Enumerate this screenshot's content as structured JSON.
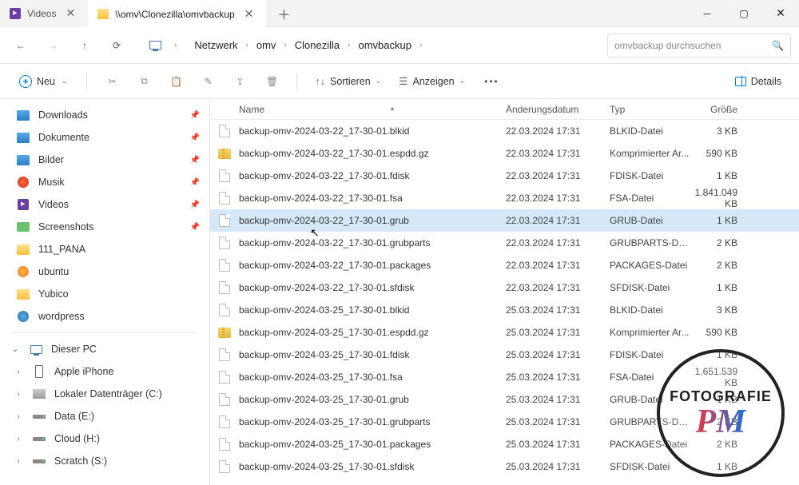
{
  "tabs": [
    {
      "label": "Videos",
      "active": false,
      "icon": "video"
    },
    {
      "label": "\\\\omv\\Clonezilla\\omvbackup",
      "active": true,
      "icon": "folder"
    }
  ],
  "breadcrumb": [
    "Netzwerk",
    "omv",
    "Clonezilla",
    "omvbackup"
  ],
  "search_placeholder": "omvbackup durchsuchen",
  "toolbar": {
    "new": "Neu",
    "sort": "Sortieren",
    "view": "Anzeigen",
    "details": "Details"
  },
  "sidebar": {
    "quick": [
      {
        "label": "Downloads",
        "icon": "folder",
        "pinned": true
      },
      {
        "label": "Dokumente",
        "icon": "folder",
        "pinned": true
      },
      {
        "label": "Bilder",
        "icon": "folder",
        "pinned": true
      },
      {
        "label": "Musik",
        "icon": "music",
        "pinned": true
      },
      {
        "label": "Videos",
        "icon": "video",
        "pinned": true
      },
      {
        "label": "Screenshots",
        "icon": "camera",
        "pinned": true
      },
      {
        "label": "111_PANA",
        "icon": "yfolder",
        "pinned": false
      },
      {
        "label": "ubuntu",
        "icon": "orange",
        "pinned": false
      },
      {
        "label": "Yubico",
        "icon": "yfolder",
        "pinned": false
      },
      {
        "label": "wordpress",
        "icon": "blue",
        "pinned": false
      }
    ],
    "pc": {
      "label": "Dieser PC"
    },
    "drives": [
      {
        "label": "Apple iPhone",
        "icon": "phone"
      },
      {
        "label": "Lokaler Datenträger (C:)",
        "icon": "drivec"
      },
      {
        "label": "Data (E:)",
        "icon": "drive"
      },
      {
        "label": "Cloud (H:)",
        "icon": "drive"
      },
      {
        "label": "Scratch (S:)",
        "icon": "drive"
      }
    ]
  },
  "columns": {
    "name": "Name",
    "date": "Änderungsdatum",
    "type": "Typ",
    "size": "Größe"
  },
  "files": [
    {
      "name": "backup-omv-2024-03-22_17-30-01.blkid",
      "date": "22.03.2024 17:31",
      "type": "BLKID-Datei",
      "size": "3 KB",
      "icon": "file"
    },
    {
      "name": "backup-omv-2024-03-22_17-30-01.espdd.gz",
      "date": "22.03.2024 17:31",
      "type": "Komprimierter Ar...",
      "size": "590 KB",
      "icon": "zip"
    },
    {
      "name": "backup-omv-2024-03-22_17-30-01.fdisk",
      "date": "22.03.2024 17:31",
      "type": "FDISK-Datei",
      "size": "1 KB",
      "icon": "file"
    },
    {
      "name": "backup-omv-2024-03-22_17-30-01.fsa",
      "date": "22.03.2024 17:31",
      "type": "FSA-Datei",
      "size": "1.841.049 KB",
      "icon": "file"
    },
    {
      "name": "backup-omv-2024-03-22_17-30-01.grub",
      "date": "22.03.2024 17:31",
      "type": "GRUB-Datei",
      "size": "1 KB",
      "icon": "file",
      "selected": true
    },
    {
      "name": "backup-omv-2024-03-22_17-30-01.grubparts",
      "date": "22.03.2024 17:31",
      "type": "GRUBPARTS-Datei",
      "size": "2 KB",
      "icon": "file"
    },
    {
      "name": "backup-omv-2024-03-22_17-30-01.packages",
      "date": "22.03.2024 17:31",
      "type": "PACKAGES-Datei",
      "size": "2 KB",
      "icon": "file"
    },
    {
      "name": "backup-omv-2024-03-22_17-30-01.sfdisk",
      "date": "22.03.2024 17:31",
      "type": "SFDISK-Datei",
      "size": "1 KB",
      "icon": "file"
    },
    {
      "name": "backup-omv-2024-03-25_17-30-01.blkid",
      "date": "25.03.2024 17:31",
      "type": "BLKID-Datei",
      "size": "3 KB",
      "icon": "file"
    },
    {
      "name": "backup-omv-2024-03-25_17-30-01.espdd.gz",
      "date": "25.03.2024 17:31",
      "type": "Komprimierter Ar...",
      "size": "590 KB",
      "icon": "zip"
    },
    {
      "name": "backup-omv-2024-03-25_17-30-01.fdisk",
      "date": "25.03.2024 17:31",
      "type": "FDISK-Datei",
      "size": "1 KB",
      "icon": "file"
    },
    {
      "name": "backup-omv-2024-03-25_17-30-01.fsa",
      "date": "25.03.2024 17:31",
      "type": "FSA-Datei",
      "size": "1.651.539 KB",
      "icon": "file"
    },
    {
      "name": "backup-omv-2024-03-25_17-30-01.grub",
      "date": "25.03.2024 17:31",
      "type": "GRUB-Datei",
      "size": "1 KB",
      "icon": "file"
    },
    {
      "name": "backup-omv-2024-03-25_17-30-01.grubparts",
      "date": "25.03.2024 17:31",
      "type": "GRUBPARTS-Datei",
      "size": "2 KB",
      "icon": "file"
    },
    {
      "name": "backup-omv-2024-03-25_17-30-01.packages",
      "date": "25.03.2024 17:31",
      "type": "PACKAGES-Datei",
      "size": "2 KB",
      "icon": "file"
    },
    {
      "name": "backup-omv-2024-03-25_17-30-01.sfdisk",
      "date": "25.03.2024 17:31",
      "type": "SFDISK-Datei",
      "size": "1 KB",
      "icon": "file"
    }
  ],
  "watermark": {
    "line1": "FOTOGRAFIE",
    "line2": "PM"
  }
}
